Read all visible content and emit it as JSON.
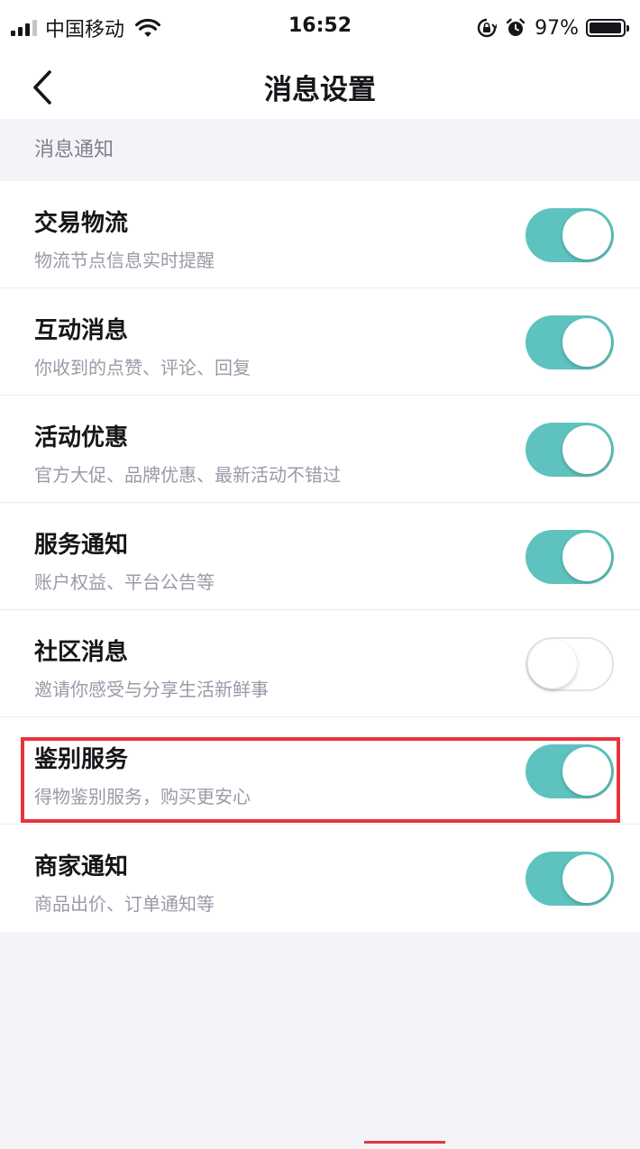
{
  "status_bar": {
    "carrier": "中国移动",
    "time": "16:52",
    "battery_percent_label": "97%",
    "battery_level": 0.97,
    "icons": [
      "signal-icon",
      "wifi-icon",
      "rotation-lock-icon",
      "alarm-icon",
      "battery-icon"
    ]
  },
  "nav": {
    "title": "消息设置",
    "back_icon": "chevron-left-icon"
  },
  "section": {
    "label": "消息通知"
  },
  "settings": [
    {
      "title": "交易物流",
      "subtitle": "物流节点信息实时提醒",
      "enabled": true
    },
    {
      "title": "互动消息",
      "subtitle": "你收到的点赞、评论、回复",
      "enabled": true
    },
    {
      "title": "活动优惠",
      "subtitle": "官方大促、品牌优惠、最新活动不错过",
      "enabled": true
    },
    {
      "title": "服务通知",
      "subtitle": "账户权益、平台公告等",
      "enabled": true
    },
    {
      "title": "社区消息",
      "subtitle": "邀请你感受与分享生活新鲜事",
      "enabled": false
    },
    {
      "title": "鉴别服务",
      "subtitle": "得物鉴别服务，购买更安心",
      "enabled": true
    },
    {
      "title": "商家通知",
      "subtitle": "商品出价、订单通知等",
      "enabled": true
    }
  ],
  "colors": {
    "toggle_on": "#5ec3bf",
    "highlight": "#e8343f",
    "background": "#f4f4f8"
  }
}
